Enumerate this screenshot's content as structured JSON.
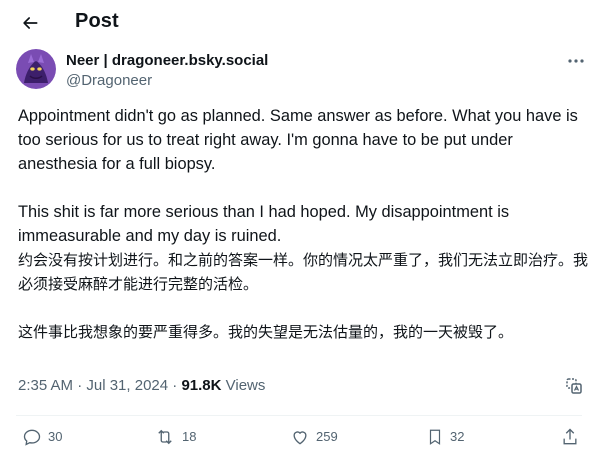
{
  "header": {
    "title": "Post"
  },
  "author": {
    "display_name": "Neer | dragoneer.bsky.social",
    "handle": "@Dragoneer"
  },
  "post": {
    "paragraphs": [
      "Appointment didn't go as planned. Same answer as before. What you have is too serious for us to treat right away. I'm gonna have to be put under anesthesia for a full biopsy.",
      "This shit is far more serious than I had hoped. My disappointment is immeasurable and my day is ruined.",
      "约会没有按计划进行。和之前的答案一样。你的情况太严重了，我们无法立即治疗。我必须接受麻醉才能进行完整的活检。",
      "这件事比我想象的要严重得多。我的失望是无法估量的，我的一天被毁了。"
    ]
  },
  "meta": {
    "timestamp": "2:35 AM · Jul 31, 2024",
    "separator": " · ",
    "views_count": "91.8K",
    "views_label": " Views"
  },
  "actions": {
    "replies": "30",
    "reposts": "18",
    "likes": "259",
    "bookmarks": "32"
  },
  "colors": {
    "text_primary": "#0f1419",
    "text_secondary": "#536471",
    "divider": "#eff3f4",
    "avatar_bg": "#6b3fa0"
  },
  "icons": {
    "back": "arrow-left-icon",
    "more": "more-horizontal-icon",
    "analytics": "translate-analytics-icon",
    "reply": "reply-icon",
    "repost": "repost-icon",
    "like": "heart-icon",
    "bookmark": "bookmark-icon",
    "share": "share-icon"
  }
}
